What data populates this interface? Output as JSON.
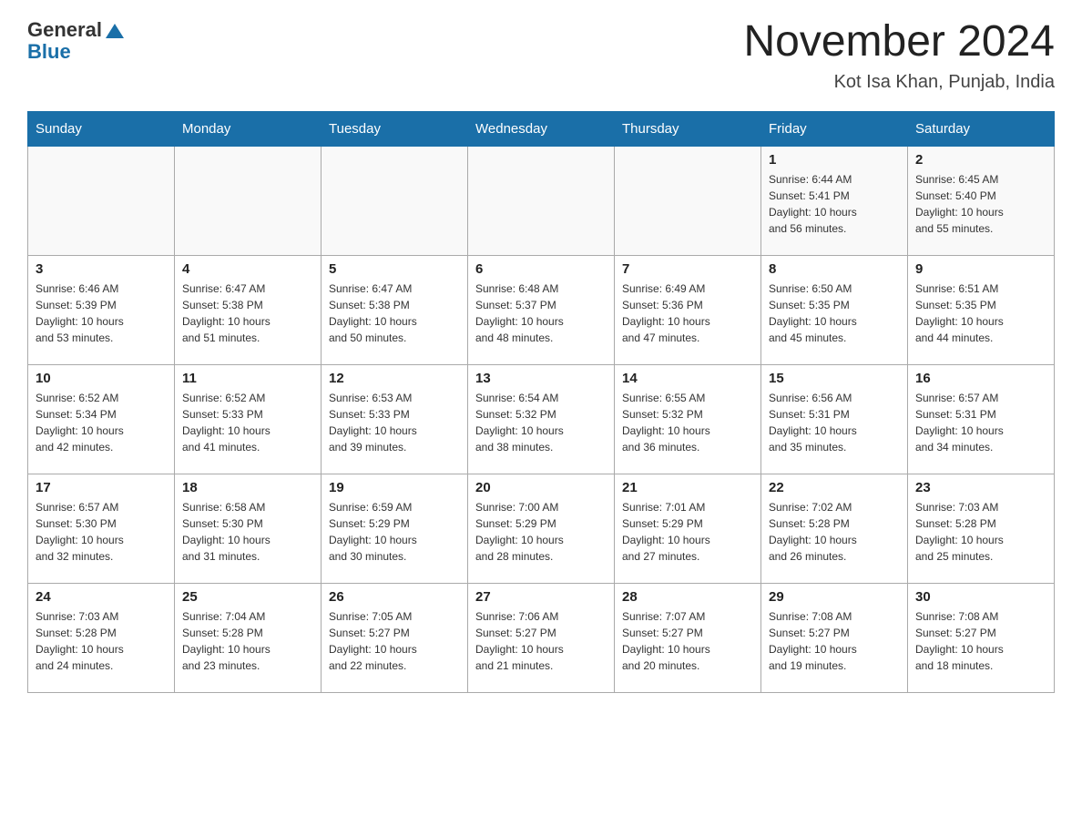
{
  "header": {
    "logo_general": "General",
    "logo_blue": "Blue",
    "month": "November 2024",
    "location": "Kot Isa Khan, Punjab, India"
  },
  "days_of_week": [
    "Sunday",
    "Monday",
    "Tuesday",
    "Wednesday",
    "Thursday",
    "Friday",
    "Saturday"
  ],
  "weeks": [
    [
      {
        "day": "",
        "info": ""
      },
      {
        "day": "",
        "info": ""
      },
      {
        "day": "",
        "info": ""
      },
      {
        "day": "",
        "info": ""
      },
      {
        "day": "",
        "info": ""
      },
      {
        "day": "1",
        "info": "Sunrise: 6:44 AM\nSunset: 5:41 PM\nDaylight: 10 hours\nand 56 minutes."
      },
      {
        "day": "2",
        "info": "Sunrise: 6:45 AM\nSunset: 5:40 PM\nDaylight: 10 hours\nand 55 minutes."
      }
    ],
    [
      {
        "day": "3",
        "info": "Sunrise: 6:46 AM\nSunset: 5:39 PM\nDaylight: 10 hours\nand 53 minutes."
      },
      {
        "day": "4",
        "info": "Sunrise: 6:47 AM\nSunset: 5:38 PM\nDaylight: 10 hours\nand 51 minutes."
      },
      {
        "day": "5",
        "info": "Sunrise: 6:47 AM\nSunset: 5:38 PM\nDaylight: 10 hours\nand 50 minutes."
      },
      {
        "day": "6",
        "info": "Sunrise: 6:48 AM\nSunset: 5:37 PM\nDaylight: 10 hours\nand 48 minutes."
      },
      {
        "day": "7",
        "info": "Sunrise: 6:49 AM\nSunset: 5:36 PM\nDaylight: 10 hours\nand 47 minutes."
      },
      {
        "day": "8",
        "info": "Sunrise: 6:50 AM\nSunset: 5:35 PM\nDaylight: 10 hours\nand 45 minutes."
      },
      {
        "day": "9",
        "info": "Sunrise: 6:51 AM\nSunset: 5:35 PM\nDaylight: 10 hours\nand 44 minutes."
      }
    ],
    [
      {
        "day": "10",
        "info": "Sunrise: 6:52 AM\nSunset: 5:34 PM\nDaylight: 10 hours\nand 42 minutes."
      },
      {
        "day": "11",
        "info": "Sunrise: 6:52 AM\nSunset: 5:33 PM\nDaylight: 10 hours\nand 41 minutes."
      },
      {
        "day": "12",
        "info": "Sunrise: 6:53 AM\nSunset: 5:33 PM\nDaylight: 10 hours\nand 39 minutes."
      },
      {
        "day": "13",
        "info": "Sunrise: 6:54 AM\nSunset: 5:32 PM\nDaylight: 10 hours\nand 38 minutes."
      },
      {
        "day": "14",
        "info": "Sunrise: 6:55 AM\nSunset: 5:32 PM\nDaylight: 10 hours\nand 36 minutes."
      },
      {
        "day": "15",
        "info": "Sunrise: 6:56 AM\nSunset: 5:31 PM\nDaylight: 10 hours\nand 35 minutes."
      },
      {
        "day": "16",
        "info": "Sunrise: 6:57 AM\nSunset: 5:31 PM\nDaylight: 10 hours\nand 34 minutes."
      }
    ],
    [
      {
        "day": "17",
        "info": "Sunrise: 6:57 AM\nSunset: 5:30 PM\nDaylight: 10 hours\nand 32 minutes."
      },
      {
        "day": "18",
        "info": "Sunrise: 6:58 AM\nSunset: 5:30 PM\nDaylight: 10 hours\nand 31 minutes."
      },
      {
        "day": "19",
        "info": "Sunrise: 6:59 AM\nSunset: 5:29 PM\nDaylight: 10 hours\nand 30 minutes."
      },
      {
        "day": "20",
        "info": "Sunrise: 7:00 AM\nSunset: 5:29 PM\nDaylight: 10 hours\nand 28 minutes."
      },
      {
        "day": "21",
        "info": "Sunrise: 7:01 AM\nSunset: 5:29 PM\nDaylight: 10 hours\nand 27 minutes."
      },
      {
        "day": "22",
        "info": "Sunrise: 7:02 AM\nSunset: 5:28 PM\nDaylight: 10 hours\nand 26 minutes."
      },
      {
        "day": "23",
        "info": "Sunrise: 7:03 AM\nSunset: 5:28 PM\nDaylight: 10 hours\nand 25 minutes."
      }
    ],
    [
      {
        "day": "24",
        "info": "Sunrise: 7:03 AM\nSunset: 5:28 PM\nDaylight: 10 hours\nand 24 minutes."
      },
      {
        "day": "25",
        "info": "Sunrise: 7:04 AM\nSunset: 5:28 PM\nDaylight: 10 hours\nand 23 minutes."
      },
      {
        "day": "26",
        "info": "Sunrise: 7:05 AM\nSunset: 5:27 PM\nDaylight: 10 hours\nand 22 minutes."
      },
      {
        "day": "27",
        "info": "Sunrise: 7:06 AM\nSunset: 5:27 PM\nDaylight: 10 hours\nand 21 minutes."
      },
      {
        "day": "28",
        "info": "Sunrise: 7:07 AM\nSunset: 5:27 PM\nDaylight: 10 hours\nand 20 minutes."
      },
      {
        "day": "29",
        "info": "Sunrise: 7:08 AM\nSunset: 5:27 PM\nDaylight: 10 hours\nand 19 minutes."
      },
      {
        "day": "30",
        "info": "Sunrise: 7:08 AM\nSunset: 5:27 PM\nDaylight: 10 hours\nand 18 minutes."
      }
    ]
  ]
}
